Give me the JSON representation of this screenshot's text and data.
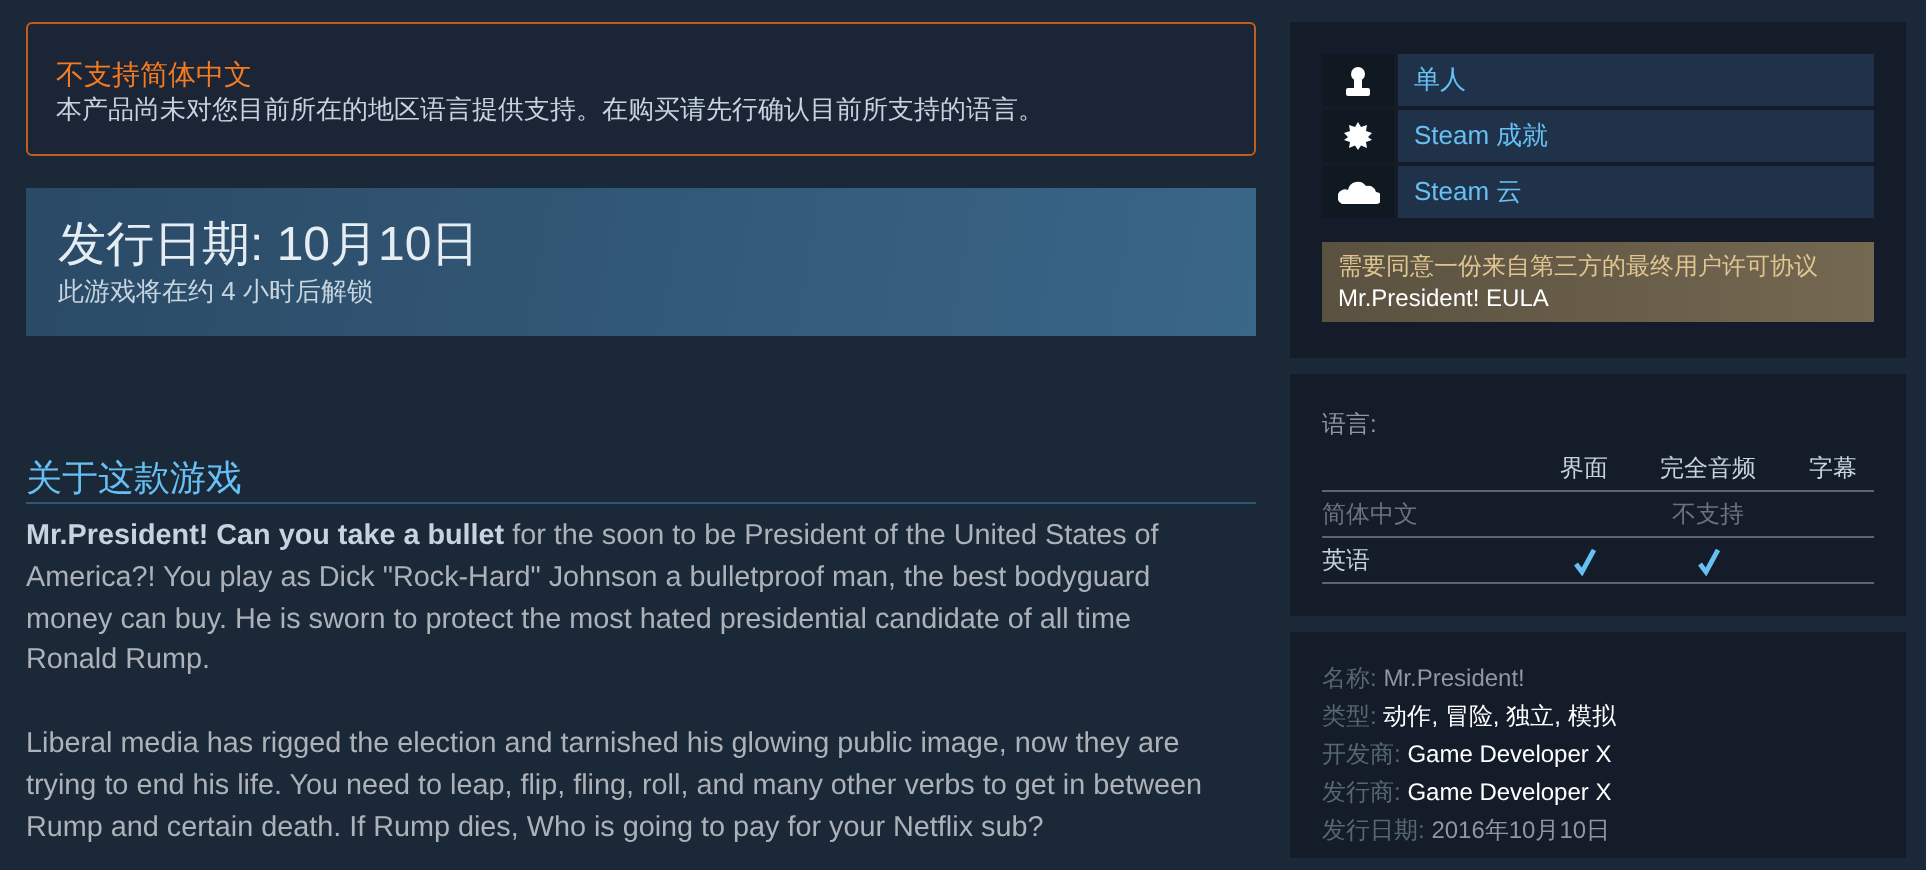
{
  "language_notice": {
    "title": "不支持简体中文",
    "text": "本产品尚未对您目前所在的地区语言提供支持。在购买请先行确认目前所支持的语言。"
  },
  "release_banner": {
    "title": "发行日期: 10月10日",
    "subtitle": "此游戏将在约 4 小时后解锁"
  },
  "about": {
    "heading": "关于这款游戏",
    "paragraphs": [
      "**Mr.President! Can you take a bullet** for the soon to be President of the United States of America?! You play as Dick \"Rock-Hard\" Johnson a bulletproof man, the best bodyguard money can buy. He is sworn to protect the most hated presidential candidate of all time Ronald Rump.",
      "Liberal media has rigged the election and tarnished his glowing public image, now they are trying to end his life. You need to leap, flip, fling, roll, and many other verbs to get in between Rump and certain death. If Rump dies, Who is going to pay for your Netflix sub?"
    ]
  },
  "features": [
    {
      "kind": "person",
      "label": "单人"
    },
    {
      "kind": "achievement",
      "label": "Steam 成就"
    },
    {
      "kind": "cloud",
      "label": "Steam 云"
    }
  ],
  "eula": {
    "text": "需要同意一份来自第三方的最终用户许可协议",
    "link": "Mr.President! EULA"
  },
  "languages": {
    "label": "语言:",
    "columns": [
      "界面",
      "完全音频",
      "字幕"
    ],
    "rows": [
      {
        "kind": "unsupported",
        "name": "简体中文",
        "note": "不支持"
      },
      {
        "kind": "supported",
        "name": "英语",
        "interface": true,
        "audio": true,
        "subtitles": false
      }
    ]
  },
  "details": [
    {
      "label": "名称:",
      "kind": "text",
      "value": "Mr.President!"
    },
    {
      "label": "类型:",
      "kind": "links",
      "separator": ",",
      "links": [
        "动作",
        "冒险",
        "独立",
        "模拟"
      ]
    },
    {
      "label": "开发商:",
      "kind": "links",
      "links": [
        "Game Developer X"
      ]
    },
    {
      "label": "发行商:",
      "kind": "links",
      "links": [
        "Game Developer X"
      ]
    },
    {
      "label": "发行日期:",
      "kind": "text",
      "value": "2016年10月10日"
    }
  ]
}
